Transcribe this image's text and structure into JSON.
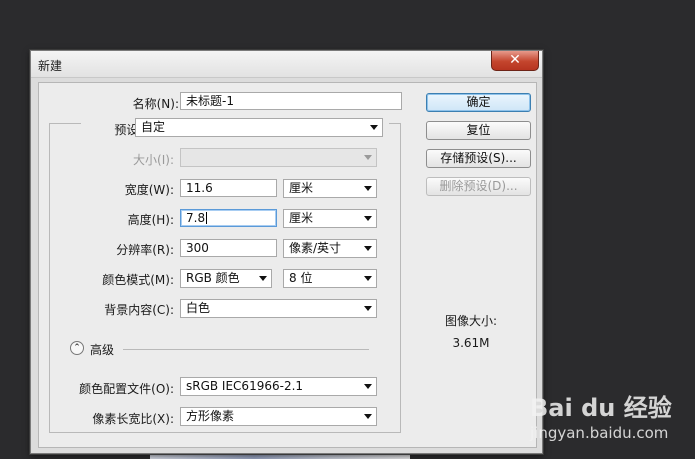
{
  "window": {
    "title": "新建",
    "close_glyph": "✕"
  },
  "form": {
    "name_label": "名称(N):",
    "name_value": "未标题-1",
    "preset_label": "预设(P):",
    "preset_value": "自定",
    "size_label": "大小(I):",
    "size_value": "",
    "width_label": "宽度(W):",
    "width_value": "11.6",
    "width_unit": "厘米",
    "height_label": "高度(H):",
    "height_value": "7.8",
    "height_unit": "厘米",
    "resolution_label": "分辨率(R):",
    "resolution_value": "300",
    "resolution_unit": "像素/英寸",
    "color_mode_label": "颜色模式(M):",
    "color_mode_value": "RGB 颜色",
    "bit_depth_value": "8 位",
    "background_label": "背景内容(C):",
    "background_value": "白色",
    "advanced_label": "高级",
    "color_profile_label": "颜色配置文件(O):",
    "color_profile_value": "sRGB IEC61966-2.1",
    "pixel_aspect_label": "像素长宽比(X):",
    "pixel_aspect_value": "方形像素"
  },
  "buttons": {
    "ok": "确定",
    "reset": "复位",
    "save_preset": "存储预设(S)...",
    "delete_preset": "删除预设(D)..."
  },
  "info": {
    "image_size_label": "图像大小:",
    "image_size_value": "3.61M"
  },
  "watermark": {
    "brand": "Bai du 经验",
    "url": "jingyan.baidu.com"
  },
  "colors": {
    "accent": "#3c7fb1",
    "close": "#c4452d",
    "background": "#2b2b2d"
  }
}
